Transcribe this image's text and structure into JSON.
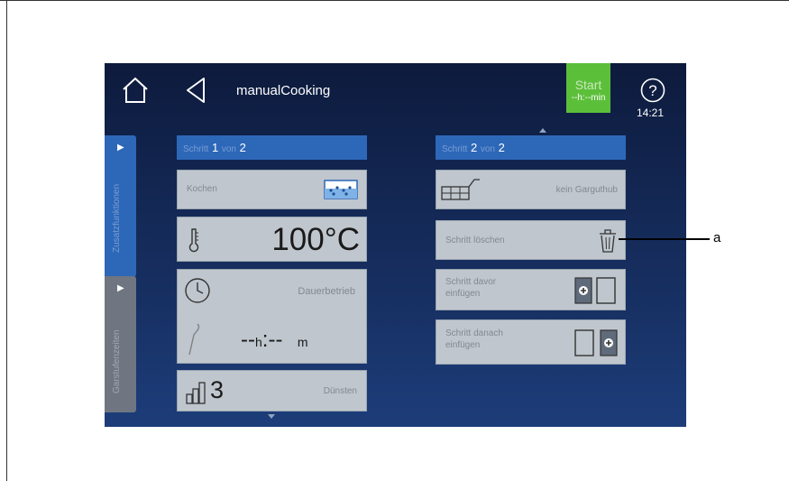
{
  "header": {
    "title": "manualCooking",
    "start_label": "Start",
    "start_time": "--h:--min",
    "clock": "14:21"
  },
  "sidebar": {
    "tab1_label": "Zusatzfunktionen",
    "tab2_label": "Garstufenzeiten"
  },
  "step1": {
    "header_prefix": "Schritt",
    "header_num": "1",
    "header_of": "von",
    "header_total": "2",
    "mode_label": "Kochen",
    "temperature": "100°C",
    "duration_label": "Dauerbetrieb",
    "time_h": "--",
    "time_h_unit": "h",
    "time_m": "--",
    "time_m_unit": "m",
    "level_value": "3",
    "level_label": "Dünsten"
  },
  "step2": {
    "header_prefix": "Schritt",
    "header_num": "2",
    "header_of": "von",
    "header_total": "2",
    "lift_label": "kein Garguthub",
    "delete_label": "Schritt löschen",
    "insert_before_line1": "Schritt davor",
    "insert_before_line2": "einfügen",
    "insert_after_line1": "Schritt danach",
    "insert_after_line2": "einfügen"
  },
  "annotation": {
    "label": "a"
  }
}
